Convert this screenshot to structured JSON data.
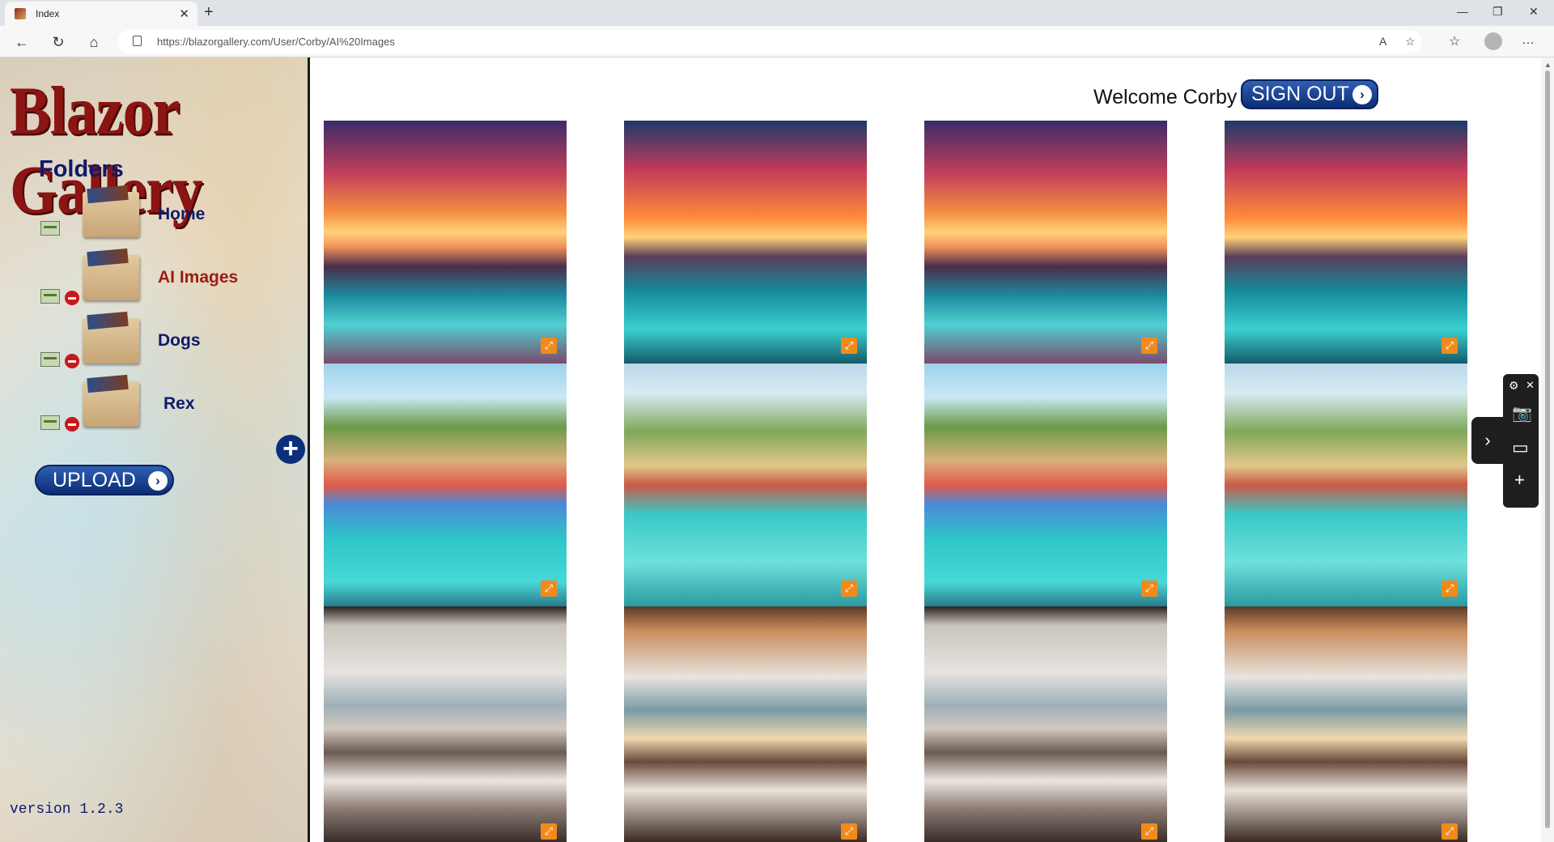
{
  "browser": {
    "tab_title": "Index",
    "tab_close": "✕",
    "new_tab": "+",
    "url": "https://blazorgallery.com/User/Corby/AI%20Images",
    "win_minimize": "—",
    "win_restore": "❐",
    "win_close": "✕"
  },
  "sidebar": {
    "logo_text": "Blazor Gallery",
    "folders_title": "Folders",
    "folders": [
      {
        "label": "Home",
        "active": false
      },
      {
        "label": "AI Images",
        "active": true
      },
      {
        "label": "Dogs",
        "active": false
      },
      {
        "label": "Rex",
        "active": false
      }
    ],
    "add_folder_symbol": "+",
    "upload_label": "UPLOAD",
    "arrow_symbol": "›",
    "version": "version 1.2.3"
  },
  "header": {
    "welcome": "Welcome Corby",
    "signout_label": "SIGN OUT"
  },
  "gallery": {
    "images": [
      {
        "icon": "sunset-resort-image"
      },
      {
        "icon": "sunset-coast-image"
      },
      {
        "icon": "sunset-pier-image"
      },
      {
        "icon": "sunset-lake-image"
      },
      {
        "icon": "harbor-town-image"
      },
      {
        "icon": "beach-village-image"
      },
      {
        "icon": "seaside-harbor-image"
      },
      {
        "icon": "coastal-pier-image"
      },
      {
        "icon": "restaurant-window-image"
      },
      {
        "icon": "dining-lake-view-image"
      },
      {
        "icon": "night-dinner-image"
      },
      {
        "icon": "evening-table-image"
      }
    ],
    "expand_symbol": "⤢"
  },
  "capture_tool": {
    "settings": "⚙",
    "close": "✕",
    "screenshot": "📷",
    "record": "▭",
    "add": "+",
    "toggle": "›"
  }
}
